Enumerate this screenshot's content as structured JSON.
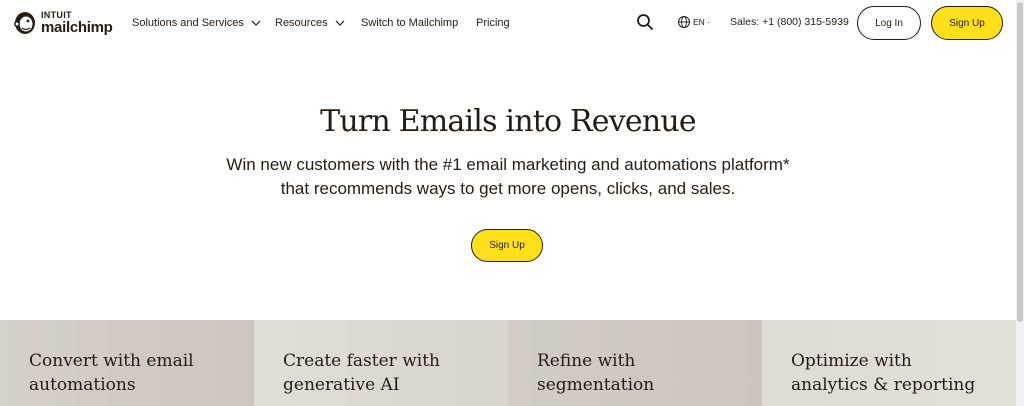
{
  "brand": {
    "top": "INTUIT",
    "name": "mailchimp"
  },
  "nav": {
    "items": [
      {
        "label": "Solutions and Services",
        "has_dropdown": true
      },
      {
        "label": "Resources",
        "has_dropdown": true
      },
      {
        "label": "Switch to Mailchimp",
        "has_dropdown": false
      },
      {
        "label": "Pricing",
        "has_dropdown": false
      }
    ],
    "language": "EN",
    "sales": "Sales: +1 (800) 315-5939",
    "login_label": "Log In",
    "signup_label": "Sign Up"
  },
  "hero": {
    "title": "Turn Emails into Revenue",
    "subtitle_line1": "Win new customers with the #1 email marketing and automations platform*",
    "subtitle_line2": "that recommends ways to get more opens, clicks, and sales.",
    "cta_label": "Sign Up"
  },
  "features": [
    {
      "line1": "Convert with email",
      "line2": "automations"
    },
    {
      "line1": "Create faster with",
      "line2": "generative AI"
    },
    {
      "line1": "Refine with",
      "line2": "segmentation"
    },
    {
      "line1": "Optimize with",
      "line2": "analytics & reporting"
    }
  ],
  "colors": {
    "accent": "#ffe01b",
    "ink": "#241c15"
  },
  "icons": [
    "freddie-logo-icon",
    "chevron-down-icon",
    "search-icon",
    "globe-icon"
  ]
}
